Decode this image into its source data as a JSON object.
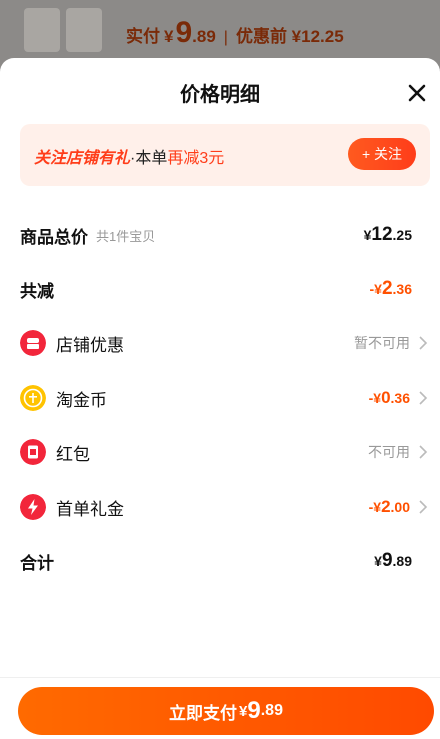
{
  "background": {
    "paid_label": "实付",
    "currency": "¥",
    "paid_int": "9",
    "paid_dec": ".89",
    "separator": "|",
    "before_label": "优惠前 ¥12.25"
  },
  "sheet": {
    "title": "价格明细"
  },
  "banner": {
    "text_bold": "关注店铺有礼",
    "text_mid": "·本单",
    "text_red": "再减3元",
    "follow_label": "+ 关注"
  },
  "rows": {
    "total": {
      "label": "商品总价",
      "sub": "共1件宝贝",
      "currency": "¥",
      "int": "12",
      "dec": ".25"
    },
    "reduce": {
      "label": "共减",
      "prefix": "-¥",
      "int": "2",
      "dec": ".36"
    },
    "shop_coupon": {
      "label": "店铺优惠",
      "status": "暂不可用"
    },
    "coin": {
      "label": "淘金币",
      "prefix": "-¥",
      "int": "0",
      "dec": ".36"
    },
    "red_packet": {
      "label": "红包",
      "status": "不可用"
    },
    "first_order": {
      "label": "首单礼金",
      "prefix": "-¥",
      "int": "2",
      "dec": ".00"
    },
    "sum": {
      "label": "合计",
      "currency": "¥",
      "int": "9",
      "dec": ".89"
    }
  },
  "pay": {
    "label": "立即支付",
    "currency": "¥",
    "int": "9",
    "dec": ".89"
  },
  "colors": {
    "accent": "#ff5000",
    "banner_bg": "#fff0ea",
    "red_text": "#ff3d1a"
  }
}
